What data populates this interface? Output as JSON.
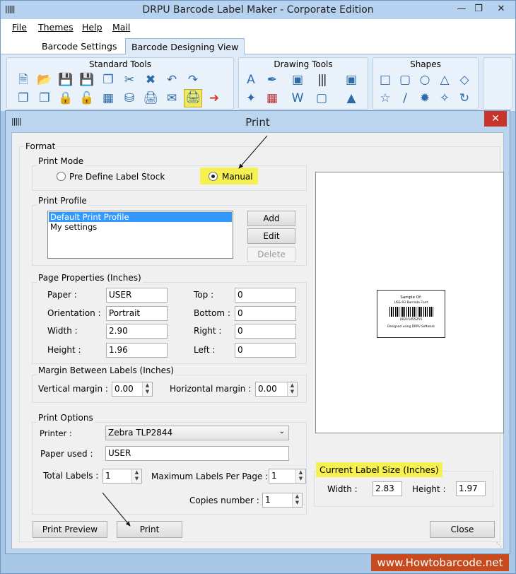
{
  "window": {
    "title": "DRPU Barcode Label Maker - Corporate Edition"
  },
  "menu": [
    "File",
    "Themes",
    "Help",
    "Mail"
  ],
  "tabs": [
    "Barcode Settings",
    "Barcode Designing View"
  ],
  "ribbon": {
    "groups": [
      "Standard Tools",
      "Drawing Tools",
      "Shapes"
    ]
  },
  "dialog": {
    "title": "Print",
    "format_label": "Format",
    "print_mode": {
      "label": "Print Mode",
      "option_predefined": "Pre Define Label Stock",
      "option_manual": "Manual",
      "selected": "Manual"
    },
    "print_profile": {
      "label": "Print Profile",
      "items": [
        "Default Print Profile",
        "My settings"
      ],
      "selected_index": 0,
      "add": "Add",
      "edit": "Edit",
      "delete": "Delete"
    },
    "page_properties": {
      "label": "Page Properties (Inches)",
      "paper_label": "Paper :",
      "paper": "USER",
      "orientation_label": "Orientation :",
      "orientation": "Portrait",
      "width_label": "Width :",
      "width": "2.90",
      "height_label": "Height :",
      "height": "1.96",
      "top_label": "Top :",
      "top": "0",
      "bottom_label": "Bottom :",
      "bottom": "0",
      "right_label": "Right :",
      "right": "0",
      "left_label": "Left :",
      "left": "0"
    },
    "margins": {
      "label": "Margin Between Labels (Inches)",
      "vertical_label": "Vertical margin :",
      "vertical": "0.00",
      "horizontal_label": "Horizontal margin :",
      "horizontal": "0.00"
    },
    "print_options": {
      "label": "Print Options",
      "printer_label": "Printer :",
      "printer": "Zebra TLP2844",
      "paper_used_label": "Paper used :",
      "paper_used": "USER",
      "total_labels_label": "Total Labels :",
      "total_labels": "1",
      "max_per_page_label": "Maximum Labels Per Page :",
      "max_per_page": "1",
      "copies_label": "Copies number :",
      "copies": "1"
    },
    "preview": {
      "label_lines": [
        "Sample Of:",
        "USS-93 Barcode Font",
        "00215455255",
        "Designed using DRPU Software"
      ]
    },
    "label_size": {
      "label": "Current Label Size (Inches)",
      "width_label": "Width :",
      "width": "2.83",
      "height_label": "Height :",
      "height": "1.97"
    },
    "buttons": {
      "preview": "Print Preview",
      "print": "Print",
      "close": "Close"
    }
  },
  "watermark": "www.Howtobarcode.net",
  "colors": {
    "highlight": "#f6f050",
    "selection": "#3399ff",
    "watermark": "#c94a1d"
  }
}
